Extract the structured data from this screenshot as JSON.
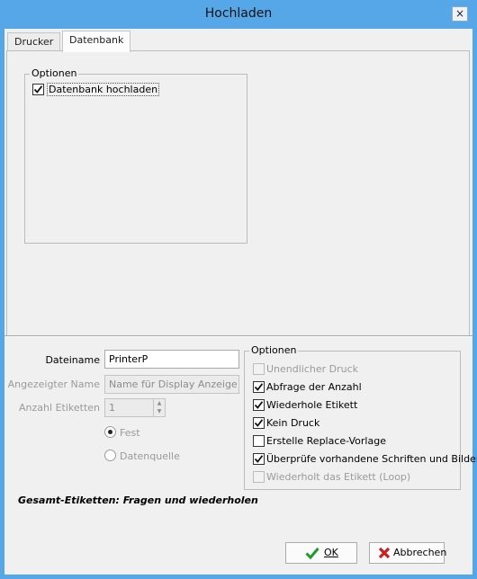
{
  "window": {
    "title": "Hochladen",
    "close_glyph": "×"
  },
  "tabs": [
    {
      "label": "Drucker",
      "active": false
    },
    {
      "label": "Datenbank",
      "active": true
    }
  ],
  "datenbank_group": {
    "title": "Optionen",
    "upload_checkbox": {
      "label": "Datenbank hochladen",
      "checked": true
    }
  },
  "form": {
    "dateiname_label": "Dateiname",
    "dateiname_value": "PrinterP",
    "display_name_label": "Angezeigter Name",
    "display_name_placeholder": "Name für Display Anzeige",
    "anzahl_label": "Anzahl Etiketten",
    "anzahl_value": "1",
    "radio_fest": "Fest",
    "radio_datenquelle": "Datenquelle"
  },
  "options": {
    "title": "Optionen",
    "items": [
      {
        "label": "Unendlicher Druck",
        "checked": false,
        "enabled": false
      },
      {
        "label": "Abfrage der Anzahl",
        "checked": true,
        "enabled": true
      },
      {
        "label": "Wiederhole Etikett",
        "checked": true,
        "enabled": true
      },
      {
        "label": "Kein Druck",
        "checked": true,
        "enabled": true
      },
      {
        "label": "Erstelle Replace-Vorlage",
        "checked": false,
        "enabled": true
      },
      {
        "label": "Überprüfe vorhandene Schriften und Bilder",
        "checked": true,
        "enabled": true
      },
      {
        "label": "Wiederholt das Etikett (Loop)",
        "checked": false,
        "enabled": false
      }
    ]
  },
  "summary": "Gesamt-Etiketten: Fragen und wiederholen",
  "buttons": {
    "ok": "OK",
    "cancel": "Abbrechen"
  },
  "colors": {
    "title_bar": "#55a7e8",
    "ok_check": "#1f9a2d",
    "cancel_x": "#c81f1f"
  },
  "icons": {
    "ok": "green-check-icon",
    "cancel": "red-x-icon",
    "close": "close-icon"
  }
}
